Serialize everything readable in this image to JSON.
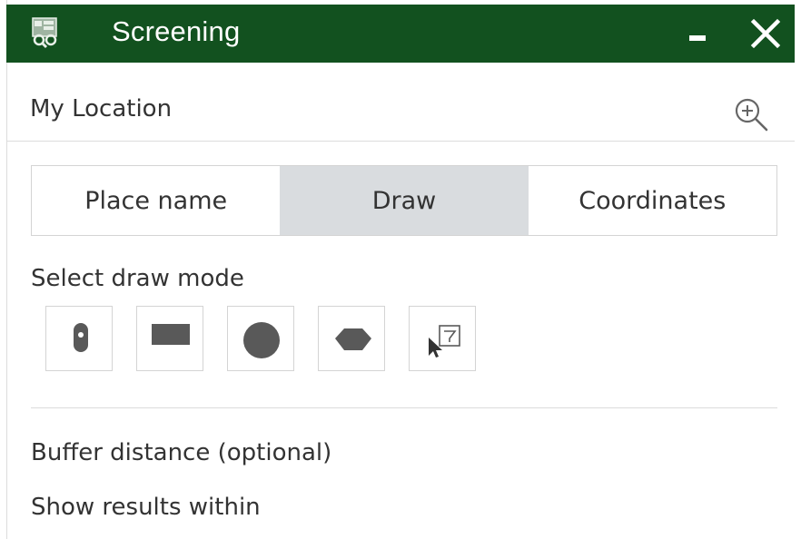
{
  "header": {
    "title": "Screening",
    "app_icon": "screening-map-icon",
    "background_color": "#12511f",
    "minimize_icon": "minimize-icon",
    "close_icon": "close-icon"
  },
  "location": {
    "label": "My Location",
    "zoom_icon": "zoom-in-icon"
  },
  "tabs": [
    {
      "label": "Place name",
      "active": false
    },
    {
      "label": "Draw",
      "active": true
    },
    {
      "label": "Coordinates",
      "active": false
    }
  ],
  "draw": {
    "label": "Select draw mode",
    "modes": [
      {
        "icon": "point-icon"
      },
      {
        "icon": "rectangle-icon"
      },
      {
        "icon": "circle-icon"
      },
      {
        "icon": "polygon-icon"
      },
      {
        "icon": "select-feature-icon"
      }
    ]
  },
  "buffer": {
    "label": "Buffer distance (optional)",
    "results_label": "Show results within"
  },
  "colors": {
    "header_bg": "#12511f",
    "active_tab_bg": "#d9dcdf",
    "icon_fill": "#595959",
    "border": "#d4d4d4"
  }
}
